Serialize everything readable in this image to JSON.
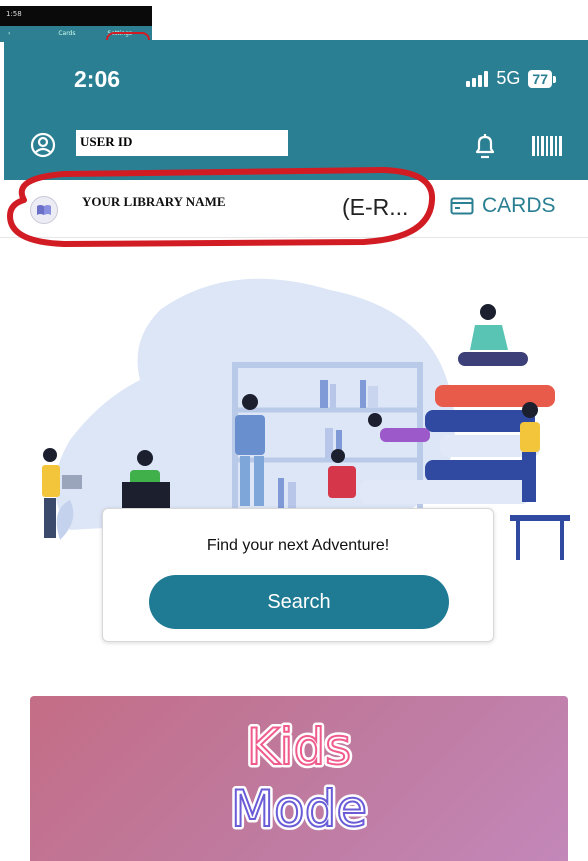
{
  "thumbnail": {
    "status_time": "1:58",
    "label_left": "‹",
    "label_mid": "Cards",
    "label_right": "Settings"
  },
  "status_bar": {
    "time": "2:06",
    "network": "5G",
    "battery": "77"
  },
  "header": {
    "user_id": "USER ID"
  },
  "library": {
    "name": "YOUR LIBRARY NAME",
    "type_truncated": "(E-R...",
    "cards_label": "CARDS"
  },
  "search": {
    "title": "Find your next Adventure!",
    "button_label": "Search"
  },
  "kids_mode": {
    "line1": "Kids",
    "line2": "Mode"
  },
  "colors": {
    "header": "#2b7f92",
    "accent": "#2b7f92",
    "search_button": "#1f7a93",
    "annotation_red": "#d21c24"
  }
}
